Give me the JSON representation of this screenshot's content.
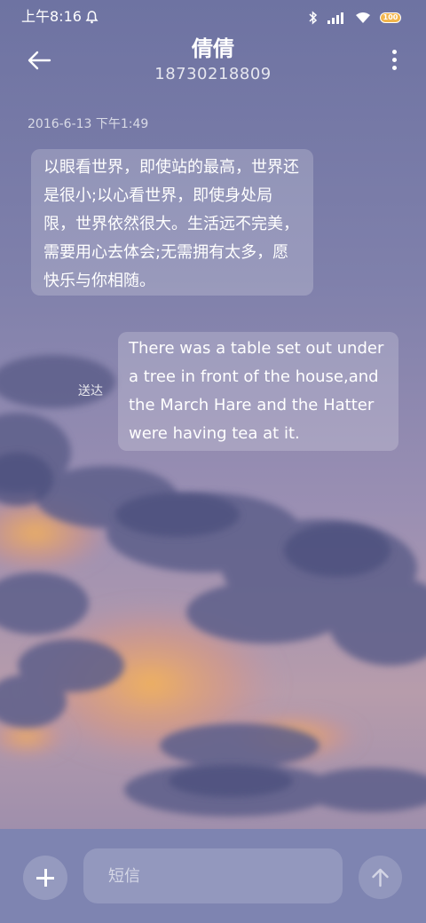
{
  "status_bar": {
    "time": "上午8:16",
    "icons": [
      "alarm-bell-icon",
      "bluetooth-icon",
      "signal-icon",
      "wifi-icon",
      "battery-icon"
    ],
    "battery_label": "100"
  },
  "header": {
    "contact_name": "倩倩",
    "phone_number": "18730218809",
    "icons": [
      "back-arrow-icon",
      "more-vertical-icon"
    ]
  },
  "conversation": {
    "timestamp": "2016-6-13 下午1:49",
    "messages": [
      {
        "direction": "incoming",
        "text": "以眼看世界，即使站的最高，世界还是很小;以心看世界，即使身处局限，世界依然很大。生活远不完美，需要用心去体会;无需拥有太多，愿快乐与你相随。"
      },
      {
        "direction": "outgoing",
        "status": "送达",
        "text": "There was a table set out under a tree in front of the house,and the March Hare and the Hatter were having tea at it."
      }
    ]
  },
  "composer": {
    "placeholder": "短信",
    "icons": [
      "add-icon",
      "send-arrow-icon"
    ]
  },
  "colors": {
    "accent_sky": "#7378a6",
    "composer_bg": "#7e84b1",
    "sunset_glow": "#f2b15a"
  }
}
